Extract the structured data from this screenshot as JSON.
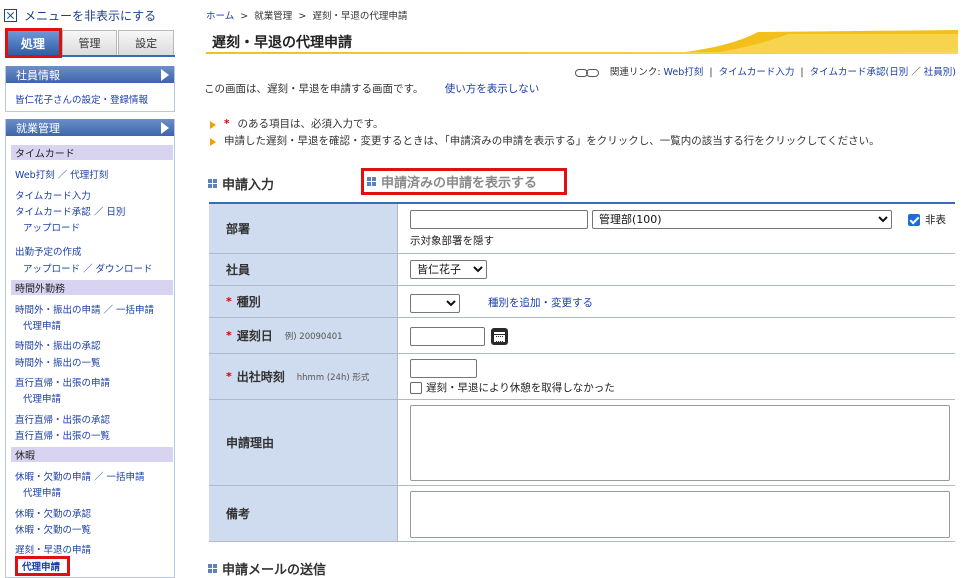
{
  "sidebar": {
    "hide_menu": "メニューを非表示にする",
    "tabs": [
      "処理",
      "管理",
      "設定"
    ],
    "employee_header": "社員情報",
    "employee_link": "皆仁花子さんの設定・登録情報",
    "work_header": "就業管理",
    "categories": {
      "timecard": "タイムカード",
      "overtime": "時間外勤務",
      "leave": "休暇"
    },
    "links": {
      "web_stamp": "Web打刻 ／ 代理打刻",
      "timecard_input": "タイムカード入力",
      "timecard_approval": "タイムカード承認 ／ 日別",
      "upload1": "アップロード",
      "schedule_create": "出勤予定の作成",
      "upload_download": "アップロード ／ ダウンロード",
      "ot_request": "時間外・振出の申請 ／ 一括申請",
      "ot_proxy": "代理申請",
      "ot_approval": "時間外・振出の承認",
      "ot_list": "時間外・振出の一覧",
      "trip_request": "直行直帰・出張の申請",
      "trip_proxy": "代理申請",
      "trip_approval": "直行直帰・出張の承認",
      "trip_list": "直行直帰・出張の一覧",
      "leave_request": "休暇・欠勤の申請 ／ 一括申請",
      "leave_proxy": "代理申請",
      "leave_approval": "休暇・欠勤の承認",
      "leave_list": "休暇・欠勤の一覧",
      "late_request": "遅刻・早退の申請",
      "late_proxy": "代理申請"
    }
  },
  "breadcrumb": {
    "home": "ホーム",
    "sep": ">",
    "work": "就業管理",
    "current": "遅刻・早退の代理申請"
  },
  "page_title": "遅刻・早退の代理申請",
  "related": {
    "label": "関連リンク:",
    "web_stamp": "Web打刻",
    "sep1": "|",
    "timecard_input": "タイムカード入力",
    "sep2": "|",
    "timecard_approval": "タイムカード承認(日別",
    "sep3": "／",
    "by_employee": "社員別)"
  },
  "intro": {
    "text": "この画面は、遅刻・早退を申請する画面です。",
    "hide_usage": "使い方を表示しない"
  },
  "notes": {
    "star": "*",
    "required": "のある項目は、必須入力です。",
    "confirm": "申請した遅刻・早退を確認・変更するときは、「申請済みの申請を表示する」をクリックし、一覧内の該当する行をクリックしてください。"
  },
  "sections": {
    "input": "申請入力",
    "show_submitted": "申請済みの申請を表示する",
    "mail": "申請メールの送信"
  },
  "form": {
    "department": {
      "label": "部署",
      "value": "",
      "select": "管理部(100)",
      "hide_label": "非表",
      "hide_label_cont": "示対象部署を隠す",
      "hide_checked": true
    },
    "employee": {
      "label": "社員",
      "select": "皆仁花子"
    },
    "type": {
      "label": "種別",
      "select": "",
      "edit_link": "種別を追加・変更する"
    },
    "date": {
      "label": "遅刻日",
      "hint": "例) 20090401",
      "value": ""
    },
    "time": {
      "label": "出社時刻",
      "hint": "hhmm (24h) 形式",
      "value": "",
      "no_break_label": "遅刻・早退により休憩を取得しなかった",
      "no_break_checked": false
    },
    "reason": {
      "label": "申請理由",
      "value": ""
    },
    "notes_field": {
      "label": "備考",
      "value": ""
    }
  },
  "colors": {
    "highlight": "#e01010",
    "accent_blue": "#3b6bb5",
    "label_bg": "#cfdbef",
    "category_bg": "#d8d3f0",
    "title_gold": "#f2c11a"
  }
}
